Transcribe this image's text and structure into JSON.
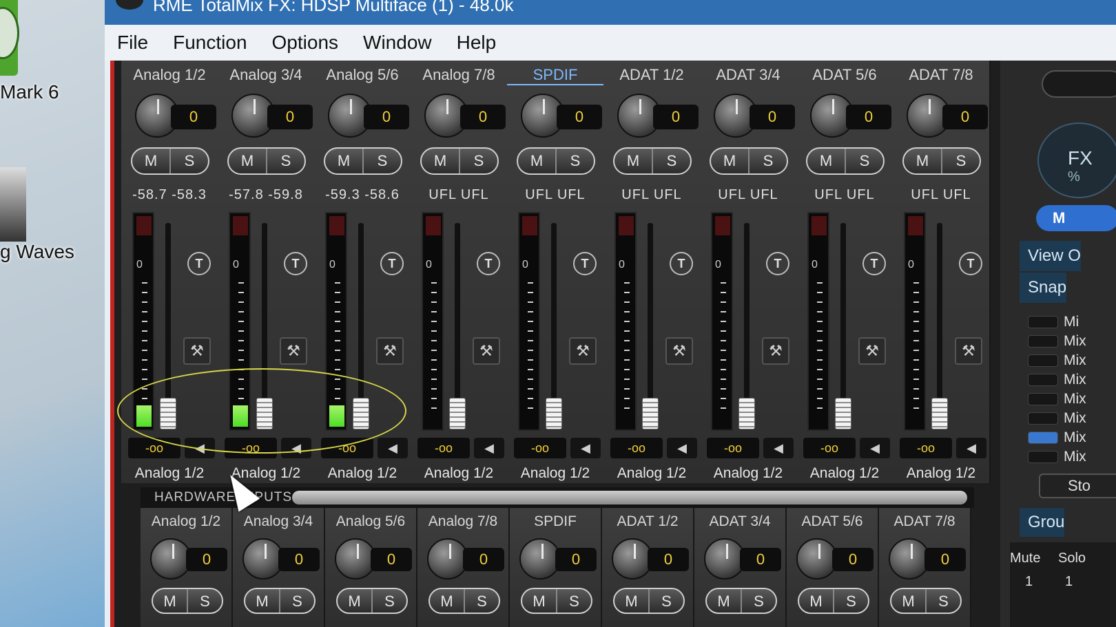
{
  "window": {
    "title": "RME TotalMix FX: HDSP Multiface (1) - 48.0k"
  },
  "desktop": {
    "icons": [
      {
        "label": "Mark 6"
      },
      {
        "label": "g Waves"
      }
    ]
  },
  "menu": [
    "File",
    "Function",
    "Options",
    "Window",
    "Help"
  ],
  "input_channels": [
    {
      "name": "Analog 1/2",
      "gain": "0",
      "mute": "M",
      "solo": "S",
      "level": "-58.7 -58.3",
      "zero_mark": "0",
      "trim": "T",
      "fader_value": "-oo",
      "routing": "Analog 1/2",
      "meter_level": 0.1
    },
    {
      "name": "Analog 3/4",
      "gain": "0",
      "mute": "M",
      "solo": "S",
      "level": "-57.8 -59.8",
      "zero_mark": "0",
      "trim": "T",
      "fader_value": "-oo",
      "routing": "Analog 1/2",
      "meter_level": 0.1
    },
    {
      "name": "Analog 5/6",
      "gain": "0",
      "mute": "M",
      "solo": "S",
      "level": "-59.3 -58.6",
      "zero_mark": "0",
      "trim": "T",
      "fader_value": "-oo",
      "routing": "Analog 1/2",
      "meter_level": 0.1
    },
    {
      "name": "Analog 7/8",
      "gain": "0",
      "mute": "M",
      "solo": "S",
      "level": "UFL UFL",
      "zero_mark": "0",
      "trim": "T",
      "fader_value": "-oo",
      "routing": "Analog 1/2",
      "meter_level": 0
    },
    {
      "name": "SPDIF",
      "gain": "0",
      "mute": "M",
      "solo": "S",
      "level": "UFL UFL",
      "zero_mark": "0",
      "trim": "T",
      "fader_value": "-oo",
      "routing": "Analog 1/2",
      "meter_level": 0
    },
    {
      "name": "ADAT 1/2",
      "gain": "0",
      "mute": "M",
      "solo": "S",
      "level": "UFL UFL",
      "zero_mark": "0",
      "trim": "T",
      "fader_value": "-oo",
      "routing": "Analog 1/2",
      "meter_level": 0
    },
    {
      "name": "ADAT 3/4",
      "gain": "0",
      "mute": "M",
      "solo": "S",
      "level": "UFL UFL",
      "zero_mark": "0",
      "trim": "T",
      "fader_value": "-oo",
      "routing": "Analog 1/2",
      "meter_level": 0
    },
    {
      "name": "ADAT 5/6",
      "gain": "0",
      "mute": "M",
      "solo": "S",
      "level": "UFL UFL",
      "zero_mark": "0",
      "trim": "T",
      "fader_value": "-oo",
      "routing": "Analog 1/2",
      "meter_level": 0
    },
    {
      "name": "ADAT 7/8",
      "gain": "0",
      "mute": "M",
      "solo": "S",
      "level": "UFL UFL",
      "zero_mark": "0",
      "trim": "T",
      "fader_value": "-oo",
      "routing": "Analog 1/2",
      "meter_level": 0
    }
  ],
  "section_label": "HARDWARE INPUTS",
  "output_channels": [
    {
      "name": "Analog 1/2",
      "gain": "0",
      "mute": "M",
      "solo": "S"
    },
    {
      "name": "Analog 3/4",
      "gain": "0",
      "mute": "M",
      "solo": "S"
    },
    {
      "name": "Analog 5/6",
      "gain": "0",
      "mute": "M",
      "solo": "S"
    },
    {
      "name": "Analog 7/8",
      "gain": "0",
      "mute": "M",
      "solo": "S"
    },
    {
      "name": "SPDIF",
      "gain": "0",
      "mute": "M",
      "solo": "S"
    },
    {
      "name": "ADAT 1/2",
      "gain": "0",
      "mute": "M",
      "solo": "S"
    },
    {
      "name": "ADAT 3/4",
      "gain": "0",
      "mute": "M",
      "solo": "S"
    },
    {
      "name": "ADAT 5/6",
      "gain": "0",
      "mute": "M",
      "solo": "S"
    },
    {
      "name": "ADAT 7/8",
      "gain": "0",
      "mute": "M",
      "solo": "S"
    }
  ],
  "right_panel": {
    "fx_label": "FX",
    "percent": "%",
    "mute_button": "M",
    "view_label": "View O",
    "snapshots_label": "Snap",
    "mixes": [
      "Mi",
      "Mix",
      "Mix",
      "Mix",
      "Mix",
      "Mix",
      "Mix",
      "Mix"
    ],
    "store_label": "Sto",
    "groups_label": "Grou",
    "groups_headers": [
      "Mute",
      "Solo"
    ],
    "groups_row": [
      "1",
      "1"
    ]
  },
  "colors": {
    "menu_bg": "#eef2f6",
    "mixer_bg": "#2e2e2e",
    "value_text": "#f2d13a",
    "meter_green": "#4edd26",
    "accent_blue": "#3a78d0"
  }
}
